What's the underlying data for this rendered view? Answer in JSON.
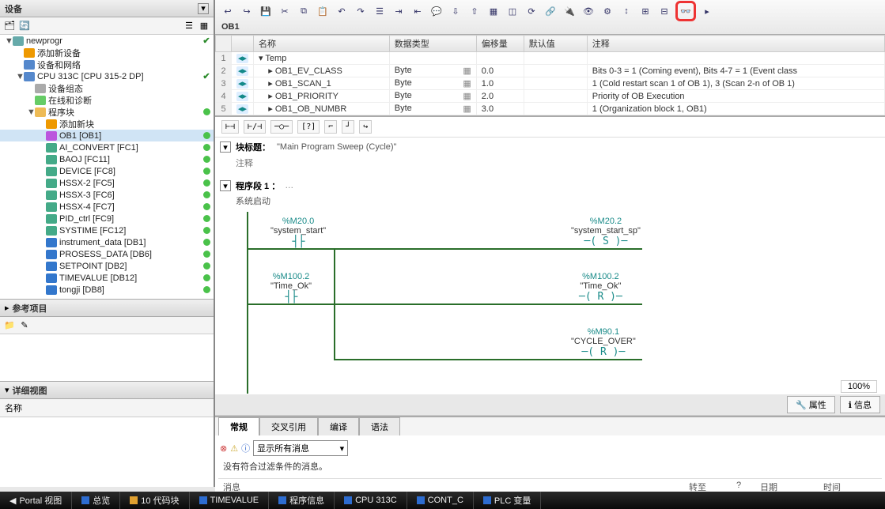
{
  "left_panel": {
    "device_label": "设备",
    "ref_label": "参考项目",
    "detail_label": "详细视图",
    "detail_col": "名称"
  },
  "tree": [
    {
      "indent": 0,
      "toggle": "▼",
      "icon": "proj",
      "label": "newprogr",
      "status": "check"
    },
    {
      "indent": 1,
      "toggle": "",
      "icon": "add",
      "label": "添加新设备",
      "status": ""
    },
    {
      "indent": 1,
      "toggle": "",
      "icon": "net",
      "label": "设备和网络",
      "status": ""
    },
    {
      "indent": 1,
      "toggle": "▼",
      "icon": "cpu",
      "label": "CPU 313C [CPU 315-2 DP]",
      "status": "check"
    },
    {
      "indent": 2,
      "toggle": "",
      "icon": "dev",
      "label": "设备组态",
      "status": ""
    },
    {
      "indent": 2,
      "toggle": "",
      "icon": "diag",
      "label": "在线和诊断",
      "status": ""
    },
    {
      "indent": 2,
      "toggle": "▼",
      "icon": "folder",
      "label": "程序块",
      "status": "dot"
    },
    {
      "indent": 3,
      "toggle": "",
      "icon": "add",
      "label": "添加新块",
      "status": ""
    },
    {
      "indent": 3,
      "toggle": "",
      "icon": "ob",
      "label": "OB1 [OB1]",
      "status": "dot",
      "selected": true
    },
    {
      "indent": 3,
      "toggle": "",
      "icon": "fc",
      "label": "AI_CONVERT [FC1]",
      "status": "dot"
    },
    {
      "indent": 3,
      "toggle": "",
      "icon": "fc",
      "label": "BAOJ [FC11]",
      "status": "dot"
    },
    {
      "indent": 3,
      "toggle": "",
      "icon": "fc",
      "label": "DEVICE [FC8]",
      "status": "dot"
    },
    {
      "indent": 3,
      "toggle": "",
      "icon": "fc",
      "label": "HSSX-2 [FC5]",
      "status": "dot"
    },
    {
      "indent": 3,
      "toggle": "",
      "icon": "fc",
      "label": "HSSX-3 [FC6]",
      "status": "dot"
    },
    {
      "indent": 3,
      "toggle": "",
      "icon": "fc",
      "label": "HSSX-4 [FC7]",
      "status": "dot"
    },
    {
      "indent": 3,
      "toggle": "",
      "icon": "fc",
      "label": "PID_ctrl [FC9]",
      "status": "dot"
    },
    {
      "indent": 3,
      "toggle": "",
      "icon": "fc",
      "label": "SYSTIME [FC12]",
      "status": "dot"
    },
    {
      "indent": 3,
      "toggle": "",
      "icon": "db",
      "label": "instrument_data [DB1]",
      "status": "dot"
    },
    {
      "indent": 3,
      "toggle": "",
      "icon": "db",
      "label": "PROSESS_DATA [DB6]",
      "status": "dot"
    },
    {
      "indent": 3,
      "toggle": "",
      "icon": "db",
      "label": "SETPOINT [DB2]",
      "status": "dot"
    },
    {
      "indent": 3,
      "toggle": "",
      "icon": "db",
      "label": "TIMEVALUE [DB12]",
      "status": "dot"
    },
    {
      "indent": 3,
      "toggle": "",
      "icon": "db",
      "label": "tongji [DB8]",
      "status": "dot"
    }
  ],
  "editor": {
    "block_name": "OB1",
    "columns": {
      "name": "名称",
      "dtype": "数据类型",
      "offset": "偏移量",
      "default": "默认值",
      "comment": "注释"
    },
    "rows": [
      {
        "n": "1",
        "icon": "▾",
        "name": "Temp",
        "dtype": "",
        "offset": "",
        "def": "",
        "comment": ""
      },
      {
        "n": "2",
        "icon": "▸",
        "name": "OB1_EV_CLASS",
        "dtype": "Byte",
        "offset": "0.0",
        "def": "",
        "comment": "Bits 0-3 = 1 (Coming event), Bits 4-7 = 1 (Event class"
      },
      {
        "n": "3",
        "icon": "▸",
        "name": "OB1_SCAN_1",
        "dtype": "Byte",
        "offset": "1.0",
        "def": "",
        "comment": "1 (Cold restart scan 1 of OB 1), 3 (Scan 2-n of OB 1)"
      },
      {
        "n": "4",
        "icon": "▸",
        "name": "OB1_PRIORITY",
        "dtype": "Byte",
        "offset": "2.0",
        "def": "",
        "comment": "Priority of OB Execution"
      },
      {
        "n": "5",
        "icon": "▸",
        "name": "OB1_OB_NUMBR",
        "dtype": "Byte",
        "offset": "3.0",
        "def": "",
        "comment": "1 (Organization block 1, OB1)"
      }
    ],
    "block_title_label": "块标题：",
    "block_title_value": "\"Main Program Sweep (Cycle)\"",
    "comment_label": "注释",
    "network_label": "程序段 1 ：",
    "network_dots": "…",
    "network_subtitle": "系统启动",
    "zoom": "100%"
  },
  "ladder": {
    "c1": {
      "addr": "%M20.0",
      "name": "\"system_start\"",
      "sym": "┤├"
    },
    "c2": {
      "addr": "%M100.2",
      "name": "\"Time_Ok\"",
      "sym": "┤├"
    },
    "o1": {
      "addr": "%M20.2",
      "name": "\"system_start_sp\"",
      "sym": "─( S )─"
    },
    "o2": {
      "addr": "%M100.2",
      "name": "\"Time_Ok\"",
      "sym": "─( R )─"
    },
    "o3": {
      "addr": "%M90.1",
      "name": "\"CYCLE_OVER\"",
      "sym": "─( R )─"
    }
  },
  "props": {
    "prop_tab": "属性",
    "info_tab": "信息"
  },
  "lower": {
    "tabs": [
      "常规",
      "交叉引用",
      "编译",
      "语法"
    ],
    "filter_label": "显示所有消息",
    "empty_msg": "没有符合过滤条件的消息。",
    "col_msg": "消息",
    "col_goto": "转至",
    "col_q": "?",
    "col_date": "日期",
    "col_time": "时间"
  },
  "bottom": {
    "items": [
      {
        "color": "#2d6cd0",
        "label": "Portal 视图"
      },
      {
        "color": "#2d6cd0",
        "label": "总览"
      },
      {
        "color": "#e0a030",
        "label": "10 代码块"
      },
      {
        "color": "#2d6cd0",
        "label": "TIMEVALUE"
      },
      {
        "color": "#2d6cd0",
        "label": "程序信息"
      },
      {
        "color": "#2d6cd0",
        "label": "CPU 313C"
      },
      {
        "color": "#2d6cd0",
        "label": "CONT_C"
      },
      {
        "color": "#2d6cd0",
        "label": "PLC 变量"
      }
    ]
  }
}
